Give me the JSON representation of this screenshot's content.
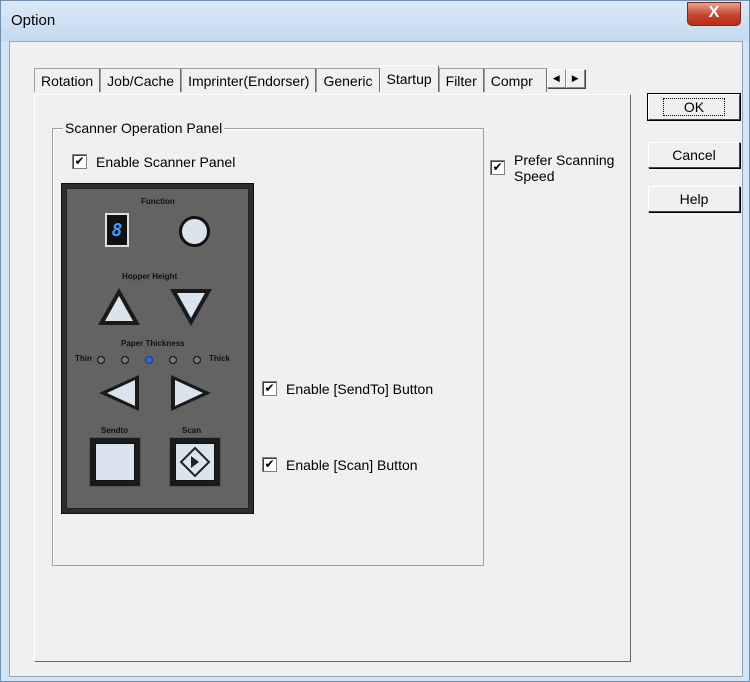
{
  "window": {
    "title": "Option",
    "close_glyph": "X"
  },
  "tabs": [
    {
      "label": "Rotation",
      "active": false
    },
    {
      "label": "Job/Cache",
      "active": false
    },
    {
      "label": "Imprinter(Endorser)",
      "active": false
    },
    {
      "label": "Generic",
      "active": false
    },
    {
      "label": "Startup",
      "active": true
    },
    {
      "label": "Filter",
      "active": false
    },
    {
      "label": "Compr",
      "active": false
    }
  ],
  "tab_scroll": {
    "left_icon": "arrow-left-icon",
    "right_icon": "arrow-right-icon",
    "left_glyph": "◀",
    "right_glyph": "▶"
  },
  "group": {
    "legend": "Scanner Operation Panel"
  },
  "checkboxes": {
    "enable_panel": {
      "label": "Enable Scanner Panel",
      "checked": true
    },
    "prefer_speed": {
      "label": "Prefer Scanning Speed",
      "checked": true
    },
    "enable_sendto": {
      "label": "Enable [SendTo] Button",
      "checked": true
    },
    "enable_scan": {
      "label": "Enable [Scan] Button",
      "checked": true
    }
  },
  "check_glyph": "✔",
  "buttons": {
    "ok": "OK",
    "cancel": "Cancel",
    "help": "Help"
  },
  "scanner_panel": {
    "function_label": "Function",
    "display_digit": "8",
    "hopper_label": "Hopper Height",
    "paper_label": "Paper Thickness",
    "thin_label": "Thin",
    "thick_label": "Thick",
    "thickness_level": 3,
    "thickness_levels": 5,
    "sendto_label": "Sendto",
    "scan_label": "Scan",
    "led_on_color": "#2f6dd6"
  }
}
